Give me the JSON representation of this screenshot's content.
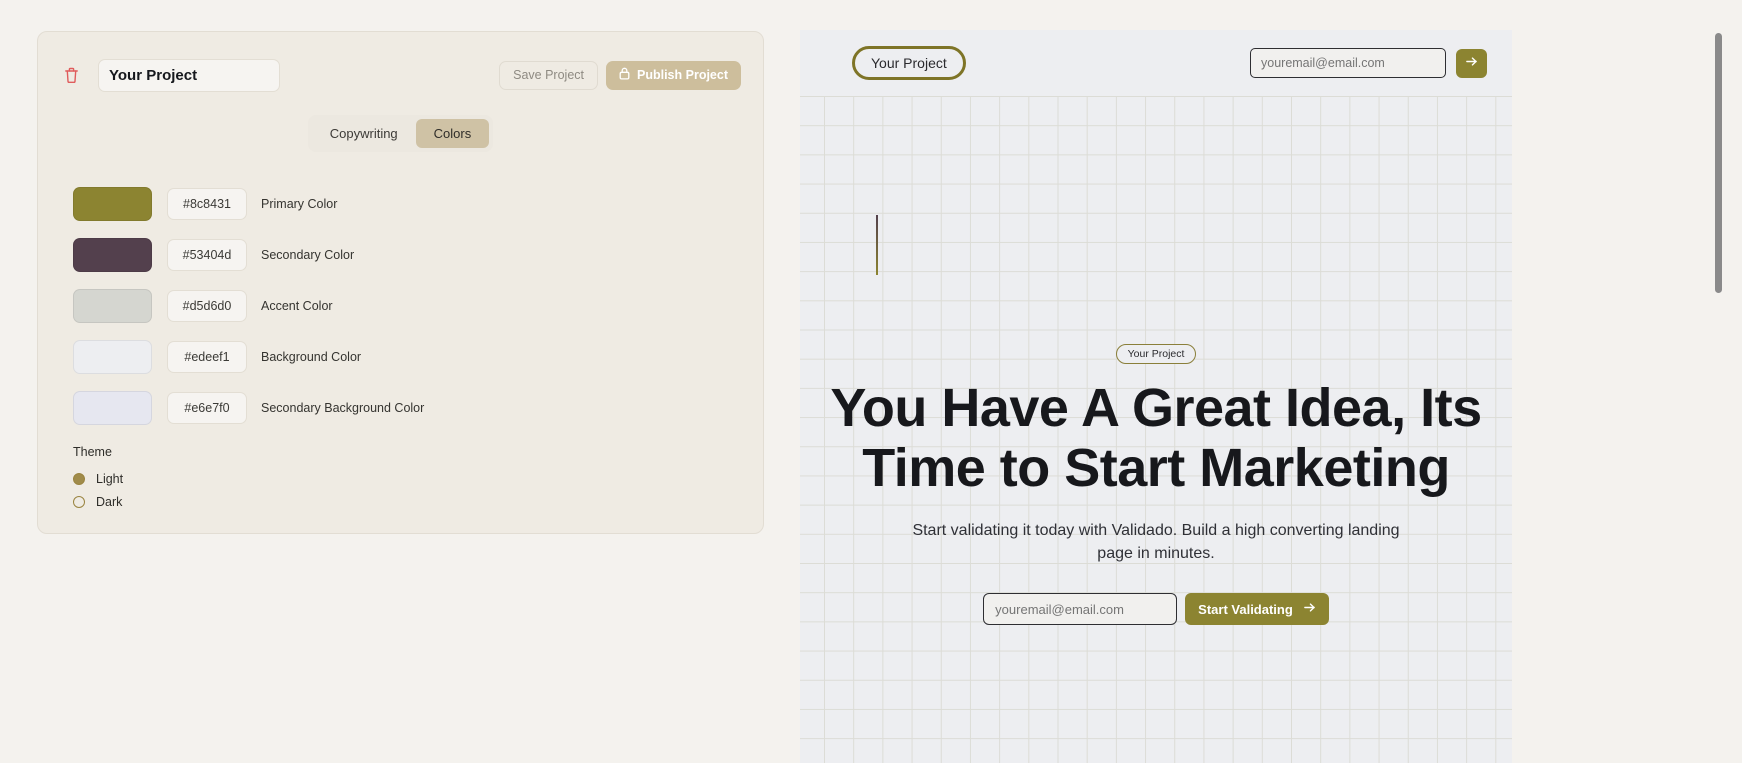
{
  "editor": {
    "trash_icon": "trash-icon",
    "project_name": "Your Project",
    "save_label": "Save Project",
    "publish_label": "Publish Project",
    "publish_icon": "lock-icon",
    "tabs": [
      {
        "label": "Copywriting",
        "active": false
      },
      {
        "label": "Colors",
        "active": true
      }
    ],
    "colors": [
      {
        "hex": "#8c8431",
        "label": "Primary Color"
      },
      {
        "hex": "#53404d",
        "label": "Secondary Color"
      },
      {
        "hex": "#d5d6d0",
        "label": "Accent Color"
      },
      {
        "hex": "#edeef1",
        "label": "Background Color"
      },
      {
        "hex": "#e6e7f0",
        "label": "Secondary Background Color"
      }
    ],
    "theme": {
      "title": "Theme",
      "options": [
        {
          "label": "Light",
          "selected": true
        },
        {
          "label": "Dark",
          "selected": false
        }
      ]
    }
  },
  "preview": {
    "nav": {
      "brand": "Your Project",
      "email_placeholder": "youremail@email.com",
      "email_value": "",
      "arrow_icon": "arrow-right-icon"
    },
    "hero": {
      "badge": "Your Project",
      "title": "You Have A Great Idea, Its Time to Start Marketing",
      "subtitle": "Start validating it today with Validado. Build a high converting landing page in minutes.",
      "email_placeholder": "youremail@email.com",
      "email_value": "",
      "cta_label": "Start Validating",
      "cta_icon": "arrow-right-icon"
    }
  },
  "accents": {
    "primary": "#8c8431",
    "publish_button": "#cdbe9c",
    "tab_active": "#cfc2a5",
    "trash": "#e05c5c"
  }
}
